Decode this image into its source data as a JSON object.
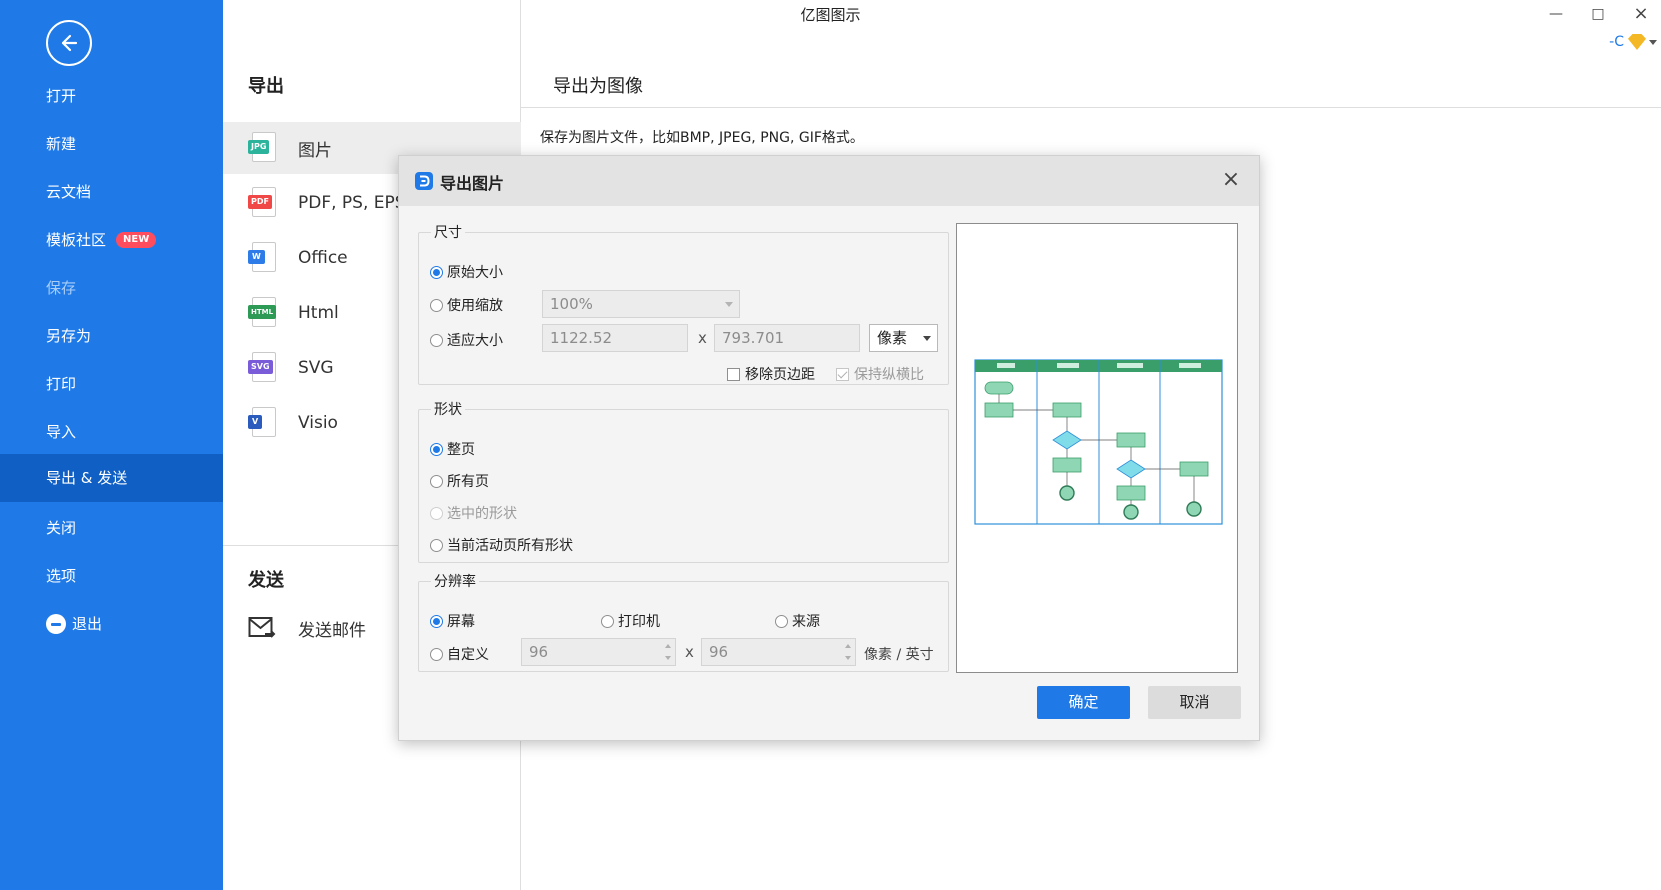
{
  "app": {
    "title": "亿图图示",
    "user_label": "-C"
  },
  "sidebar": {
    "items": [
      {
        "label": "打开"
      },
      {
        "label": "新建"
      },
      {
        "label": "云文档"
      },
      {
        "label": "模板社区",
        "badge": "NEW"
      },
      {
        "label": "保存"
      },
      {
        "label": "另存为"
      },
      {
        "label": "打印"
      },
      {
        "label": "导入"
      },
      {
        "label": "导出 & 发送"
      },
      {
        "label": "关闭"
      },
      {
        "label": "选项"
      },
      {
        "label": "退出"
      }
    ]
  },
  "mid": {
    "export_title": "导出",
    "formats": [
      {
        "label": "图片",
        "tag": "JPG",
        "color": "#2bb39b"
      },
      {
        "label": "PDF, PS, EPS",
        "tag": "PDF",
        "color": "#f04747"
      },
      {
        "label": "Office",
        "tag": "W",
        "color": "#2e7ce8"
      },
      {
        "label": "Html",
        "tag": "HTML",
        "color": "#2d9a55"
      },
      {
        "label": "SVG",
        "tag": "SVG",
        "color": "#7a5bd8"
      },
      {
        "label": "Visio",
        "tag": "V",
        "color": "#2a5bbd"
      }
    ],
    "send_title": "发送",
    "send_mail": "发送邮件"
  },
  "right": {
    "heading": "导出为图像",
    "description": "保存为图片文件，比如BMP, JPEG, PNG, GIF格式。"
  },
  "dialog": {
    "title": "导出图片",
    "size": {
      "legend": "尺寸",
      "original": "原始大小",
      "zoom": "使用缩放",
      "zoom_value": "100%",
      "fit": "适应大小",
      "width": "1122.52",
      "height": "793.701",
      "times": "x",
      "unit": "像素",
      "remove_margin": "移除页边距",
      "keep_ratio": "保持纵横比"
    },
    "shape": {
      "legend": "形状",
      "whole_page": "整页",
      "all_pages": "所有页",
      "selected": "选中的形状",
      "current_all": "当前活动页所有形状"
    },
    "resolution": {
      "legend": "分辨率",
      "screen": "屏幕",
      "printer": "打印机",
      "source": "来源",
      "custom": "自定义",
      "dpi_x": "96",
      "dpi_y": "96",
      "times": "x",
      "unit": "像素 / 英寸"
    },
    "ok": "确定",
    "cancel": "取消"
  },
  "colors": {
    "accent": "#1f7ae8",
    "sidebar_active": "#0f5fc4",
    "badge": "#ff4d5e",
    "swimlane_header": "#3a9e6a",
    "swimlane_border": "#2f8fd8",
    "shape_fill": "#8fd6b5"
  }
}
